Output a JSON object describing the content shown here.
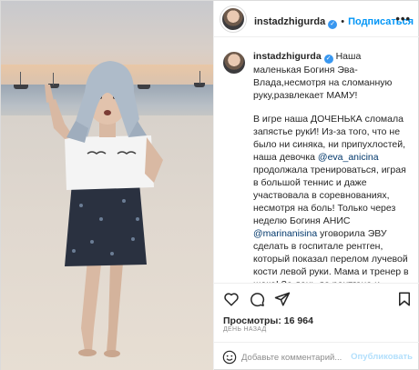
{
  "header": {
    "username": "instadzhigurda",
    "verified_icon": "verified-badge-icon",
    "separator": "•",
    "follow_label": "Подписаться",
    "more_label": "•••"
  },
  "caption": {
    "username": "instadzhigurda",
    "line1": "Наша маленькая Богиня Эва-Влада,несмотря на сломанную руку,развлекает МАМУ!",
    "p2_start": "В игре наша ДОЧЕНЬКА сломала запястье рукИ! Из-за того, что не было ни синяка, ни припухлостей, наша девочка ",
    "mention1": "@eva_anicina",
    "p2_end": " продолжала тренироваться, играя в большой теннис и даже участвовала в соревнованиях, несмотря на боль! Только через неделю Богиня АНИС ",
    "mention2": "@marinanisina",
    "p2_tail": " уговорила ЭВУ сделать в госпитале рентген, который показал перелом лучевой кости левой руки. Мама и тренер в шоке! За день до рентгена и наложения гипса, наша ДОЧЕНЬКА импровизировала на пляже океана, "
  },
  "actions": {
    "like_icon": "heart-icon",
    "comment_icon": "comment-icon",
    "share_icon": "share-icon",
    "save_icon": "bookmark-icon"
  },
  "stats": {
    "views": "Просмотры: 16 964",
    "date": "ДЕНЬ НАЗАД"
  },
  "comment": {
    "emoji_icon": "smiley-icon",
    "placeholder": "Добавьте комментарий...",
    "publish_label": "Опубликовать"
  },
  "colors": {
    "link": "#00376b",
    "accent": "#0095f6",
    "publish_disabled": "#b2dffc",
    "verified": "#3897f0"
  }
}
